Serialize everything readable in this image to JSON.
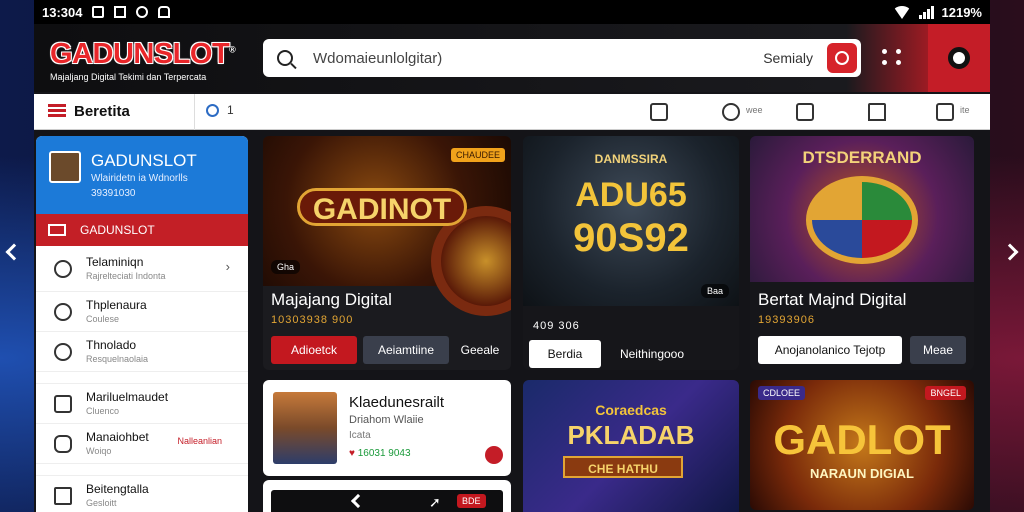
{
  "status_bar": {
    "time": "13:304",
    "battery": "1219%"
  },
  "header": {
    "logo": "GADUNSLOT",
    "tagline": "Majaljang Digital Tekimi dan Terpercata",
    "search_placeholder": "Wdomaieunlolgitar)",
    "sort_label": "Semialy"
  },
  "toolbar": {
    "title": "Beretita",
    "count": "1",
    "label_a": "wee",
    "label_b": "ite"
  },
  "sidebar": {
    "profile": {
      "name": "GADUNSLOT",
      "sub": "Wlairidetn ia Wdnorlls",
      "num": "39391030"
    },
    "active_label": "GADUNSLOT",
    "items": [
      {
        "title": "Telaminiqn",
        "sub": "Rajrelteciati Indonta"
      },
      {
        "title": "Thplenaura",
        "sub": "Coulese"
      },
      {
        "title": "Thnolado",
        "sub": "Resquelnaolaia"
      },
      {
        "title": "Mariluelmaudet",
        "sub": "Cluenco"
      },
      {
        "title": "Manaiohbet",
        "sub": "Woiqo",
        "badge": "Nalleanlian"
      },
      {
        "title": "Beitengtalla",
        "sub": "Gesloitt"
      }
    ]
  },
  "cards": {
    "c1": {
      "art": "GADINOT",
      "tag": "CHAUDEE",
      "pill": "Gha",
      "title": "Majajang Digital",
      "price": "10303938 900",
      "btn1": "Adioetck",
      "btn2": "Aeiamtiine",
      "btn3": "Geeale"
    },
    "c2": {
      "art_top": "DANMSSIRA",
      "art_line1": "ADU65",
      "art_line2": "90S92",
      "pill": "Baa",
      "price": "409 306",
      "btn1": "Berdia",
      "btn2": "Neithingooo"
    },
    "c3": {
      "art": "DTSDERRAND",
      "title": "Bertat Majnd Digital",
      "price": "19393906",
      "btn1": "Anojanolanico Tejotp",
      "btn2": "Meae"
    },
    "c4": {
      "title": "Klaedunesrailt",
      "sub": "Driahom Wlaiie",
      "sub2": "Icata",
      "price": "16031 9043"
    },
    "c5": {
      "art_top": "Coraedcas",
      "art_line1": "PKLADAB",
      "art_line2": "CHE HATHU"
    },
    "c6": {
      "tag": "CDLOEE",
      "tag2": "BNGEL",
      "art": "GADLOT",
      "art_sub": "NARAUN DIGIAL"
    },
    "c7": {
      "tag": "BDE"
    }
  },
  "colors": {
    "accent": "#c41d27",
    "blue": "#1c7ad8",
    "gold": "#e2a534"
  }
}
